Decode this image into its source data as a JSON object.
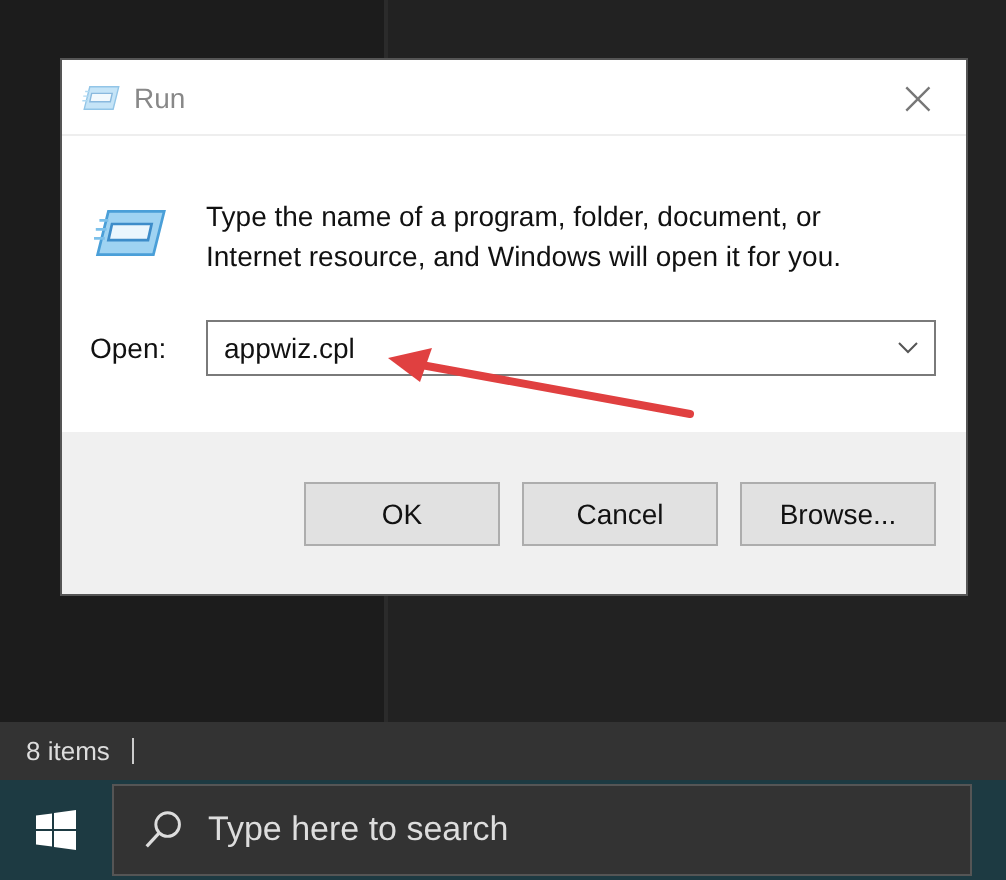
{
  "window": {
    "title": "Run",
    "close": "×"
  },
  "prompt": "Type the name of a program, folder, document, or Internet resource, and Windows will open it for you.",
  "open_field": {
    "label": "Open:",
    "value": "appwiz.cpl"
  },
  "buttons": [
    "OK",
    "Cancel",
    "Browse..."
  ],
  "status_bar": {
    "items": "8 items"
  },
  "taskbar": {
    "search": {
      "placeholder": "Type here to search"
    }
  }
}
